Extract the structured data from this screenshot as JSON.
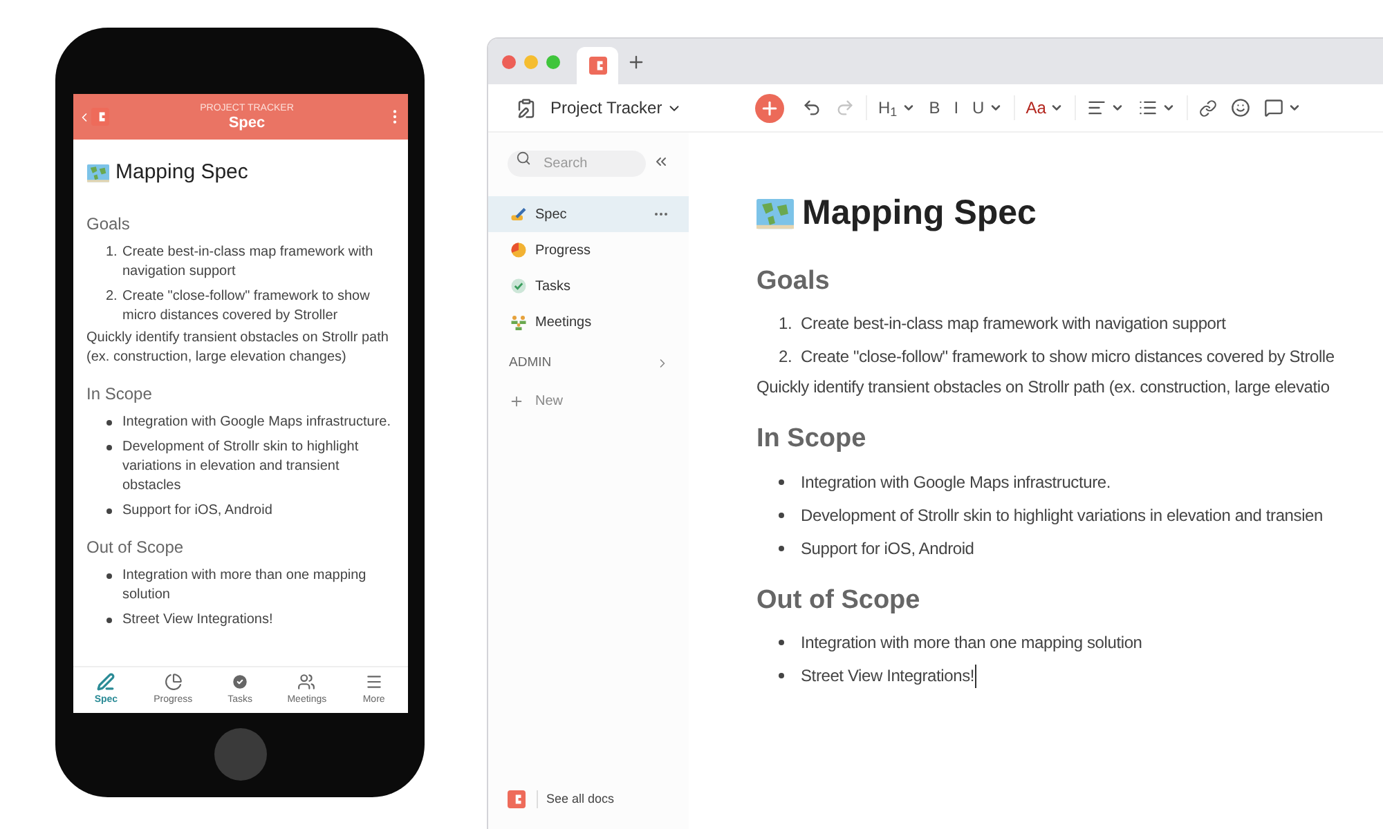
{
  "phone": {
    "header": {
      "overline": "PROJECT TRACKER",
      "title": "Spec"
    },
    "doc": {
      "title": "Mapping Spec",
      "blocks": [
        {
          "kind": "heading",
          "text": "Goals"
        },
        {
          "kind": "numbered",
          "items": [
            {
              "marker": "1.",
              "text": "Create best-in-class map framework with navigation support"
            },
            {
              "marker": "2.",
              "text": "Create \"close-follow\" framework to show micro distances covered by Stroller"
            }
          ]
        },
        {
          "kind": "paragraph",
          "text": "Quickly identify transient obstacles on Strollr path (ex. construction, large elevation changes)"
        },
        {
          "kind": "heading",
          "text": "In Scope"
        },
        {
          "kind": "bulleted",
          "items": [
            {
              "text": "Integration with Google Maps infrastructure."
            },
            {
              "text": "Development of Strollr skin to highlight variations in elevation and transient obstacles"
            },
            {
              "text": "Support for iOS, Android"
            }
          ]
        },
        {
          "kind": "heading",
          "text": "Out of Scope"
        },
        {
          "kind": "bulleted",
          "items": [
            {
              "text": "Integration with more than one mapping solution"
            },
            {
              "text": "Street View Integrations!"
            }
          ]
        }
      ]
    },
    "tabs": [
      {
        "label": "Spec",
        "kind": "spec",
        "selected": true
      },
      {
        "label": "Progress",
        "kind": "progress",
        "selected": false
      },
      {
        "label": "Tasks",
        "kind": "tasks",
        "selected": false
      },
      {
        "label": "Meetings",
        "kind": "meetings",
        "selected": false
      },
      {
        "label": "More",
        "kind": "more",
        "selected": false
      }
    ]
  },
  "browser": {
    "toolbar": {
      "doc_title": "Project Tracker",
      "tools": [
        {
          "kind": "add",
          "disabled": false,
          "menu": false
        },
        {
          "kind": "undo",
          "disabled": false,
          "menu": false
        },
        {
          "kind": "redo",
          "disabled": true,
          "menu": false
        },
        {
          "kind": "text",
          "label": "H$_{1}$",
          "disabled": false,
          "menu": true
        },
        {
          "kind": "text",
          "label": "B",
          "disabled": false,
          "menu": false
        },
        {
          "kind": "text",
          "label": "I",
          "disabled": false,
          "menu": false
        },
        {
          "kind": "text",
          "label": "U",
          "disabled": false,
          "menu": true
        },
        {
          "kind": "color",
          "label": "Aa",
          "disabled": false,
          "menu": true
        },
        {
          "kind": "align",
          "disabled": false,
          "menu": true
        },
        {
          "kind": "list",
          "disabled": false,
          "menu": true
        },
        {
          "kind": "link",
          "disabled": false,
          "menu": false
        },
        {
          "kind": "emoji",
          "disabled": false,
          "menu": false
        },
        {
          "kind": "comment",
          "disabled": false,
          "menu": true
        }
      ]
    },
    "sidebar": {
      "search": {
        "placeholder": "Search"
      },
      "items": [
        {
          "label": "Spec",
          "kind": "spec",
          "selected": true
        },
        {
          "label": "Progress",
          "kind": "progress",
          "selected": false
        },
        {
          "label": "Tasks",
          "kind": "tasks",
          "selected": false
        },
        {
          "label": "Meetings",
          "kind": "meetings",
          "selected": false
        }
      ],
      "section": "ADMIN",
      "new": "New",
      "footer": "See all docs"
    },
    "doc": {
      "title": "Mapping Spec",
      "blocks": [
        {
          "kind": "heading",
          "text": "Goals"
        },
        {
          "kind": "numbered",
          "items": [
            {
              "marker": "1.",
              "text": "Create best-in-class map framework with navigation support",
              "cursor": false
            },
            {
              "marker": "2.",
              "text": "Create \"close-follow\" framework to show micro distances covered by Strolle",
              "cursor": false
            }
          ]
        },
        {
          "kind": "paragraph",
          "text": "Quickly identify transient obstacles on Strollr path (ex. construction, large elevatio"
        },
        {
          "kind": "heading",
          "text": "In Scope"
        },
        {
          "kind": "bulleted",
          "items": [
            {
              "text": "Integration with Google Maps infrastructure.",
              "cursor": false
            },
            {
              "text": "Development of Strollr skin to highlight variations in elevation and transien",
              "cursor": false
            },
            {
              "text": "Support for iOS, Android",
              "cursor": false
            }
          ]
        },
        {
          "kind": "heading",
          "text": "Out of Scope"
        },
        {
          "kind": "bulleted",
          "items": [
            {
              "text": "Integration with more than one mapping solution",
              "cursor": false
            },
            {
              "text": "Street View Integrations!",
              "cursor": true
            }
          ]
        }
      ]
    }
  }
}
